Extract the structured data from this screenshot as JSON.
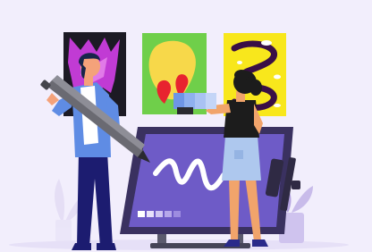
{
  "illustration": {
    "artworks": [
      {
        "name": "magenta-splash-artwork",
        "colors": [
          "#1c1a24",
          "#c13bd4",
          "#e17ae8"
        ]
      },
      {
        "name": "yellow-blob-artwork",
        "colors": [
          "#6fcf4a",
          "#f7d84a",
          "#e8232f"
        ]
      },
      {
        "name": "purple-swirl-artwork",
        "colors": [
          "#f8e71c",
          "#3a0f46",
          "#ffffff"
        ]
      }
    ],
    "colors": {
      "background": "#f2eefc",
      "tablet_frame": "#3a3160",
      "tablet_screen": "#6e5bc7",
      "man_shirt": "#5f8ce4",
      "man_pants": "#1c1c70",
      "woman_top": "#1c1c1c",
      "woman_skirt": "#aec8ee",
      "color_swatch": "#8fb0ef",
      "plant": "#b5a4e0"
    },
    "icons": [
      "stylus-icon",
      "swatch-palette-icon",
      "plant-icon",
      "squiggle-stroke-icon"
    ]
  }
}
